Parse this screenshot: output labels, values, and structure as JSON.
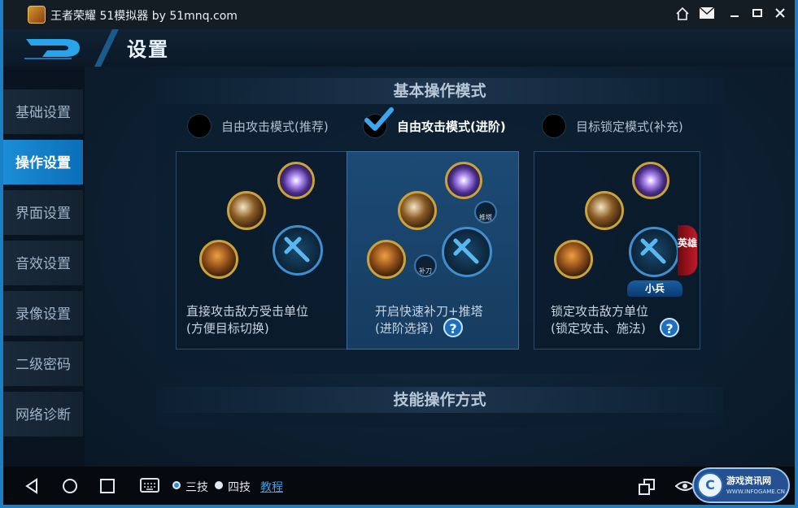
{
  "window": {
    "title": "王者荣耀  51模拟器 by 51mnq.com",
    "controls": [
      "home-icon",
      "mail-icon",
      "minimize-icon",
      "maximize-icon",
      "close-icon"
    ]
  },
  "header": {
    "title": "设置"
  },
  "sidebar": {
    "items": [
      {
        "label": "基础设置",
        "active": false
      },
      {
        "label": "操作设置",
        "active": true
      },
      {
        "label": "界面设置",
        "active": false
      },
      {
        "label": "音效设置",
        "active": false
      },
      {
        "label": "录像设置",
        "active": false
      },
      {
        "label": "二级密码",
        "active": false
      },
      {
        "label": "网络诊断",
        "active": false
      }
    ]
  },
  "basic_mode": {
    "title": "基本操作模式",
    "options": [
      {
        "label": "自由攻击模式(推荐)",
        "selected": false
      },
      {
        "label": "自由攻击模式(进阶)",
        "selected": true
      },
      {
        "label": "目标锁定模式(补充)",
        "selected": false
      }
    ],
    "cards": [
      {
        "line1": "直接攻击敌方受击单位",
        "line2": "(方便目标切换)",
        "help": false
      },
      {
        "line1": "开启快速补刀+推塔",
        "line2": "(进阶选择)",
        "help": true,
        "help_label": "?",
        "mini1": "推塔",
        "mini2": "补刀"
      },
      {
        "line1": "锁定攻击敌方单位",
        "line2": "(锁定攻击、施法)",
        "help": true,
        "help_label": "?",
        "hero_badge": "英雄",
        "minion_badge": "小兵"
      }
    ]
  },
  "skill_mode": {
    "title": "技能操作方式"
  },
  "bottom": {
    "nav": [
      "back-icon",
      "home-circle-icon",
      "recents-icon",
      "keyboard-icon"
    ],
    "mode_options": [
      {
        "label": "三技",
        "selected": true
      },
      {
        "label": "四技",
        "selected": false
      }
    ],
    "tutorial": "教程",
    "right_icons": [
      "multi-window-icon",
      "eye-icon"
    ]
  },
  "watermark": {
    "text": "游戏资讯网",
    "sub": "WWW.INFOGAME.CN",
    "mark": "C"
  },
  "colors": {
    "accent": "#1b8ed6",
    "panel": "#0c1e30",
    "help": "#1e6fc0",
    "hero_red": "#c21a28"
  }
}
